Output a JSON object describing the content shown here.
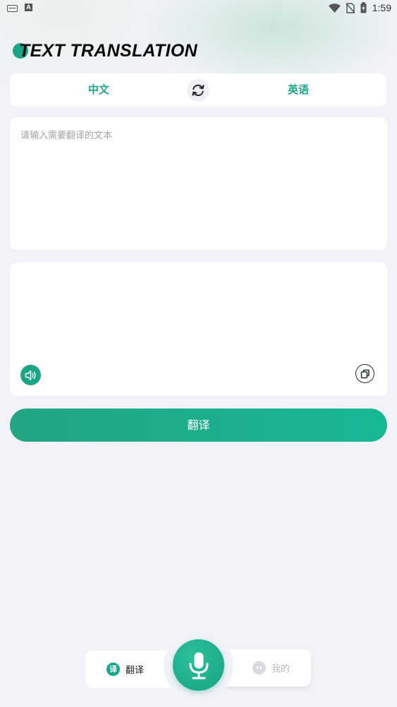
{
  "status_bar": {
    "time": "1:59",
    "left_icons": [
      "keyboard-icon",
      "a-icon"
    ],
    "right_icons": [
      "wifi-icon",
      "no-sim-icon",
      "battery-charging-icon"
    ],
    "a_icon_text": "A"
  },
  "header": {
    "title": "TEXT TRANSLATION"
  },
  "language_bar": {
    "source_language": "中文",
    "target_language": "英语",
    "swap_icon": "swap-refresh-icon"
  },
  "input": {
    "placeholder": "请输入需要翻译的文本",
    "value": ""
  },
  "output": {
    "text": "",
    "speak_icon": "speaker-icon",
    "copy_icon": "copy-icon"
  },
  "actions": {
    "translate_label": "翻译"
  },
  "bottom_nav": {
    "tabs": [
      {
        "label": "翻译",
        "icon_text": "译",
        "active": true
      },
      {
        "label": "我的",
        "active": false
      }
    ],
    "mic_icon": "microphone-icon"
  },
  "colors": {
    "accent": "#1aa587",
    "background": "#f2f3f8",
    "card": "#ffffff"
  }
}
